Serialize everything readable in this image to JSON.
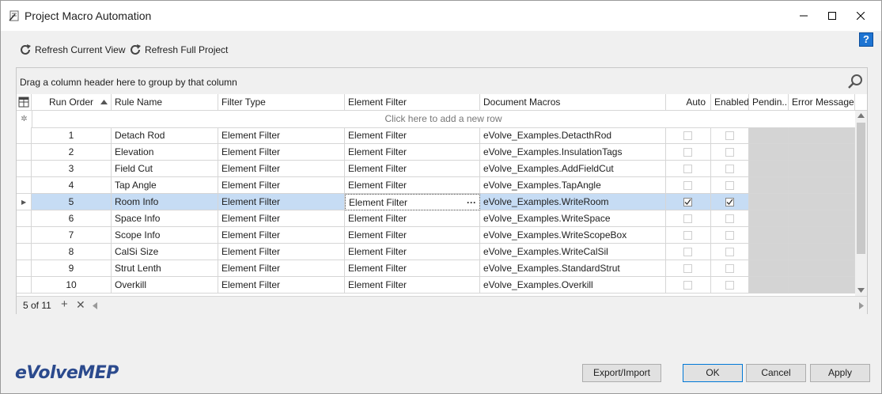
{
  "window": {
    "title": "Project Macro Automation",
    "help_label": "?"
  },
  "toolbar": {
    "refresh_current_label": "Refresh Current View",
    "refresh_full_label": "Refresh Full Project"
  },
  "grid": {
    "group_panel_text": "Drag a column header here to group by that column",
    "columns": [
      "Run Order",
      "Rule Name",
      "Filter Type",
      "Element Filter",
      "Document Macros",
      "Auto",
      "Enabled",
      "Pendin...",
      "Error Message"
    ],
    "new_row_text": "Click here to add a new row",
    "rows": [
      {
        "run_order": "1",
        "rule_name": "Detach Rod",
        "filter_type": "Element Filter",
        "element_filter": "Element Filter",
        "document_macros": "eVolve_Examples.DetacthRod",
        "auto": false,
        "enabled": false
      },
      {
        "run_order": "2",
        "rule_name": "Elevation",
        "filter_type": "Element Filter",
        "element_filter": "Element Filter",
        "document_macros": "eVolve_Examples.InsulationTags",
        "auto": false,
        "enabled": false
      },
      {
        "run_order": "3",
        "rule_name": "Field Cut",
        "filter_type": "Element Filter",
        "element_filter": "Element Filter",
        "document_macros": "eVolve_Examples.AddFieldCut",
        "auto": false,
        "enabled": false
      },
      {
        "run_order": "4",
        "rule_name": "Tap Angle",
        "filter_type": "Element Filter",
        "element_filter": "Element Filter",
        "document_macros": "eVolve_Examples.TapAngle",
        "auto": false,
        "enabled": false
      },
      {
        "run_order": "5",
        "rule_name": "Room Info",
        "filter_type": "Element Filter",
        "element_filter": "Element Filter",
        "document_macros": "eVolve_Examples.WriteRoom",
        "auto": true,
        "enabled": true
      },
      {
        "run_order": "6",
        "rule_name": "Space Info",
        "filter_type": "Element Filter",
        "element_filter": "Element Filter",
        "document_macros": "eVolve_Examples.WriteSpace",
        "auto": false,
        "enabled": false
      },
      {
        "run_order": "7",
        "rule_name": "Scope Info",
        "filter_type": "Element Filter",
        "element_filter": "Element Filter",
        "document_macros": "eVolve_Examples.WriteScopeBox",
        "auto": false,
        "enabled": false
      },
      {
        "run_order": "8",
        "rule_name": "CalSi Size",
        "filter_type": "Element Filter",
        "element_filter": "Element Filter",
        "document_macros": "eVolve_Examples.WriteCalSil",
        "auto": false,
        "enabled": false
      },
      {
        "run_order": "9",
        "rule_name": "Strut Lenth",
        "filter_type": "Element Filter",
        "element_filter": "Element Filter",
        "document_macros": "eVolve_Examples.StandardStrut",
        "auto": false,
        "enabled": false
      },
      {
        "run_order": "10",
        "rule_name": "Overkill",
        "filter_type": "Element Filter",
        "element_filter": "Element Filter",
        "document_macros": "eVolve_Examples.Overkill",
        "auto": false,
        "enabled": false
      }
    ],
    "selected_row_index": 4,
    "ellipsis_label": "···",
    "record_nav": "5 of 11",
    "sort_column": "Run Order",
    "sort_direction": "ascending"
  },
  "buttons": {
    "export_import": "Export/Import",
    "ok": "OK",
    "cancel": "Cancel",
    "apply": "Apply"
  },
  "logo": {
    "text": "eVolveMEP"
  },
  "colors": {
    "selection": "#c6dcf4",
    "accent": "#0078d7",
    "help_blue": "#1e74d2",
    "logo": "#2b4a8d"
  }
}
